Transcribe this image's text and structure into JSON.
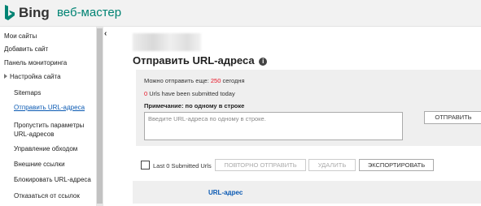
{
  "header": {
    "brand": "Bing",
    "product": "веб-мастер",
    "colors": {
      "brand_icon": "#008373",
      "product": "#008373"
    }
  },
  "sidebar": {
    "items": [
      {
        "label": "Мои сайты"
      },
      {
        "label": "Добавить сайт"
      },
      {
        "label": "Панель мониторинга"
      },
      {
        "label": "Настройка сайта"
      },
      {
        "label": "Sitemaps"
      },
      {
        "label": "Отправить URL-адреса"
      },
      {
        "label": "Пропустить параметры URL-адресов"
      },
      {
        "label": "Управление обходом"
      },
      {
        "label": "Внешние ссылки"
      },
      {
        "label": "Блокировать URL-адреса"
      },
      {
        "label": "Отказаться от ссылок"
      }
    ],
    "collapse_glyph": "‹"
  },
  "main": {
    "title": "Отправить URL-адреса",
    "quota": {
      "prefix": "Можно отправить еще: ",
      "value": "250",
      "suffix": " сегодня"
    },
    "submitted": {
      "count": "0",
      "text": " Urls have been submitted today"
    },
    "note": "Примечание: по одному в строке",
    "textarea_placeholder": "Введите URL-адреса по одному в строке.",
    "submit_label": "ОТПРАВИТЬ",
    "checkbox_label": "Last 0 Submitted Urls",
    "resubmit_label": "ПОВТОРНО ОТПРАВИТЬ",
    "delete_label": "УДАЛИТЬ",
    "export_label": "ЭКСПОРТИРОВАТЬ",
    "table": {
      "columns": [
        "URL-адрес"
      ]
    },
    "colors": {
      "accent_red": "#e81123",
      "link_blue": "#0b5ab3"
    }
  }
}
